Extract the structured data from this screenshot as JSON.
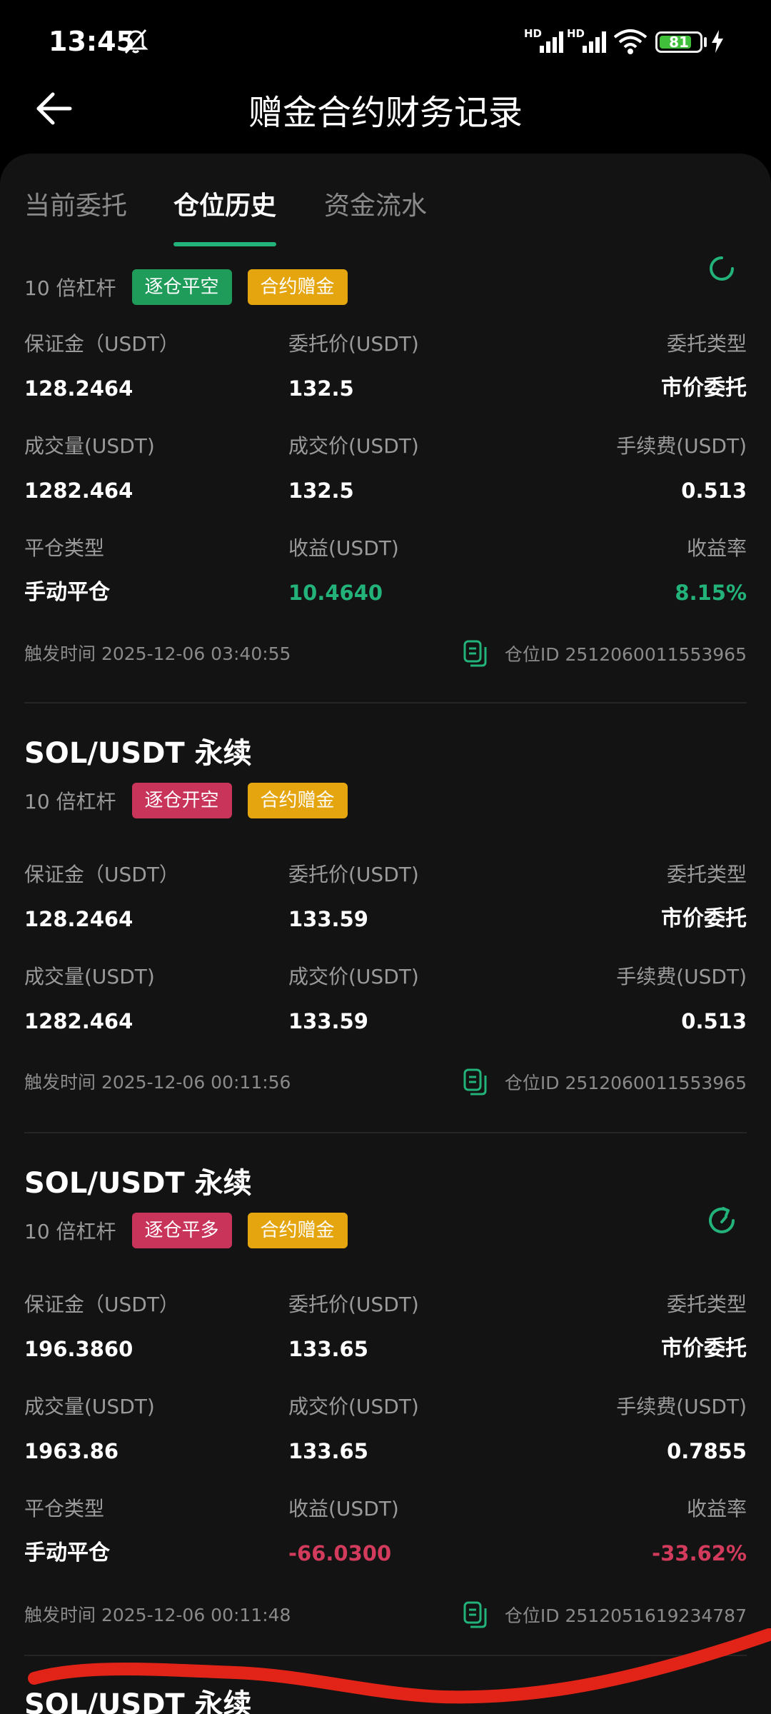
{
  "status_bar": {
    "time": "13:45",
    "battery": "81",
    "battery_level": 0.81,
    "signal_label": "HD"
  },
  "header": {
    "title": "赠金合约财务记录"
  },
  "tabs": [
    {
      "label": "当前委托"
    },
    {
      "label": "仓位历史",
      "active": true
    },
    {
      "label": "资金流水"
    }
  ],
  "colors": {
    "accent": "#22b27a",
    "negative": "#d33b5d",
    "tag_yellow": "#e4a50f",
    "background": "#131313"
  },
  "records": [
    {
      "pair": "",
      "leverage": "10 倍杠杆",
      "tags": [
        "逐仓平空",
        "合约赠金"
      ],
      "margin_label": "保证金（USDT）",
      "margin": "128.2464",
      "order_price_label": "委托价(USDT)",
      "order_price": "132.5",
      "order_type_label": "委托类型",
      "order_type": "市价委托",
      "volume_label": "成交量(USDT)",
      "volume": "1282.464",
      "fill_price_label": "成交价(USDT)",
      "fill_price": "132.5",
      "fee_label": "手续费(USDT)",
      "fee": "0.513",
      "close_type_label": "平仓类型",
      "close_type": "手动平仓",
      "pnl_label": "收益(USDT)",
      "pnl": "10.4640",
      "roi_label": "收益率",
      "roi": "8.15%",
      "trigger_time": "触发时间 2025-12-06 03:40:55",
      "position_id": "仓位ID 2512060011553965"
    },
    {
      "pair": "SOL/USDT 永续",
      "leverage": "10 倍杠杆",
      "tags": [
        "逐仓开空",
        "合约赠金"
      ],
      "margin_label": "保证金（USDT）",
      "margin": "128.2464",
      "order_price_label": "委托价(USDT)",
      "order_price": "133.59",
      "order_type_label": "委托类型",
      "order_type": "市价委托",
      "volume_label": "成交量(USDT)",
      "volume": "1282.464",
      "fill_price_label": "成交价(USDT)",
      "fill_price": "133.59",
      "fee_label": "手续费(USDT)",
      "fee": "0.513",
      "trigger_time": "触发时间 2025-12-06 00:11:56",
      "position_id": "仓位ID 2512060011553965"
    },
    {
      "pair": "SOL/USDT 永续",
      "leverage": "10 倍杠杆",
      "tags": [
        "逐仓平多",
        "合约赠金"
      ],
      "margin_label": "保证金（USDT）",
      "margin": "196.3860",
      "order_price_label": "委托价(USDT)",
      "order_price": "133.65",
      "order_type_label": "委托类型",
      "order_type": "市价委托",
      "volume_label": "成交量(USDT)",
      "volume": "1963.86",
      "fill_price_label": "成交价(USDT)",
      "fill_price": "133.65",
      "fee_label": "手续费(USDT)",
      "fee": "0.7855",
      "close_type_label": "平仓类型",
      "close_type": "手动平仓",
      "pnl_label": "收益(USDT)",
      "pnl": "-66.0300",
      "roi_label": "收益率",
      "roi": "-33.62%",
      "trigger_time": "触发时间 2025-12-06 00:11:48",
      "position_id": "仓位ID 2512051619234787"
    },
    {
      "pair": "SOL/USDT 永续"
    }
  ]
}
